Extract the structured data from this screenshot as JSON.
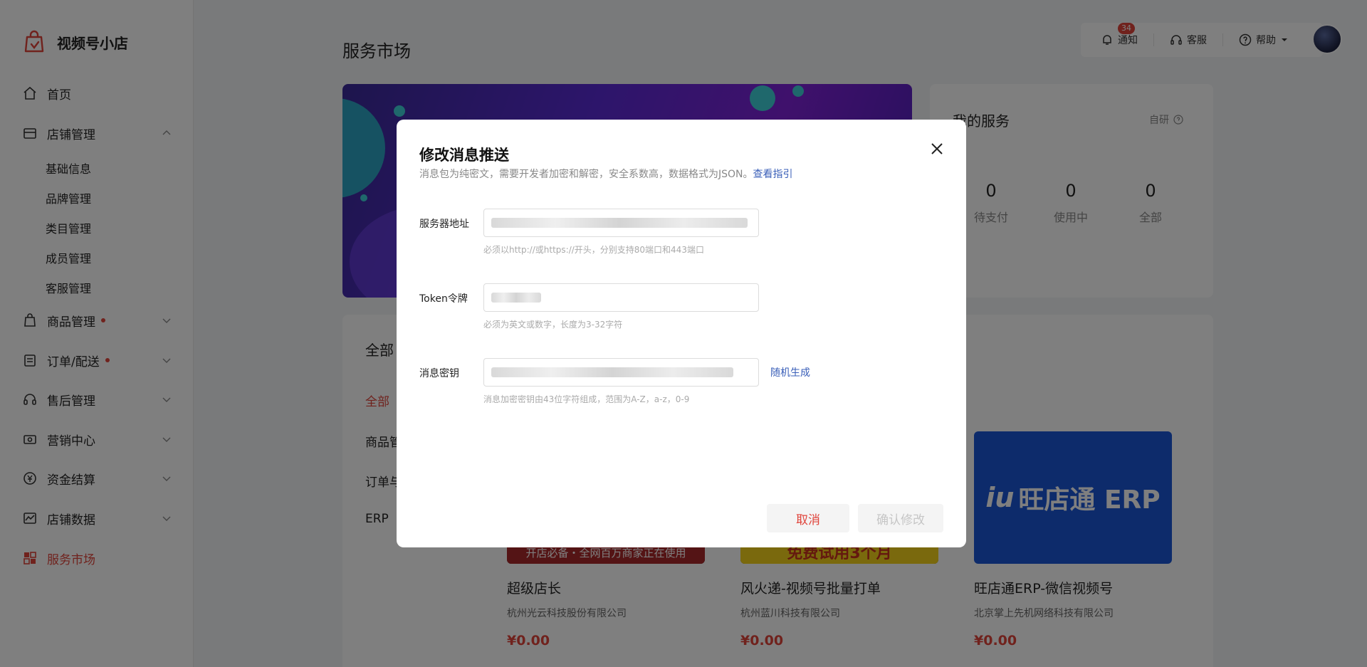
{
  "app": {
    "name": "视频号小店"
  },
  "sidebar": {
    "home": "首页",
    "store_mgmt": "店铺管理",
    "store_sub": [
      "基础信息",
      "品牌管理",
      "类目管理",
      "成员管理",
      "客服管理"
    ],
    "goods_mgmt": "商品管理",
    "orders": "订单/配送",
    "after_sales": "售后管理",
    "marketing": "营销中心",
    "finance": "资金结算",
    "store_data": "店铺数据",
    "service_market": "服务市场"
  },
  "header": {
    "page_title": "服务市场",
    "notify_label": "通知",
    "notify_count": "34",
    "support_label": "客服",
    "help_label": "帮助"
  },
  "my_service": {
    "title": "我的服务",
    "self_label": "自研",
    "stats": [
      {
        "value": "0",
        "label": "待支付"
      },
      {
        "value": "0",
        "label": "使用中"
      },
      {
        "value": "0",
        "label": "全部"
      }
    ]
  },
  "market": {
    "title": "全部",
    "categories": [
      "全部",
      "商品管",
      "订单与",
      "ERP"
    ],
    "products": [
      {
        "name": "超级店长",
        "company": "杭州光云科技股份有限公司",
        "price": "¥0.00",
        "banner_text": "开店必备・全网百万商家正在使用"
      },
      {
        "name": "风火递-视频号批量打单",
        "company": "杭州蓝川科技有限公司",
        "price": "¥0.00",
        "banner_text": "免费试用3个月"
      },
      {
        "name": "旺店通ERP-微信视频号",
        "company": "北京掌上先机网络科技有限公司",
        "price": "¥0.00",
        "logo_text": "旺店通 ERP"
      }
    ]
  },
  "dialog": {
    "title": "修改消息推送",
    "description": "消息包为纯密文，需要开发者加密和解密，安全系数高，数据格式为JSON。",
    "guide_link": "查看指引",
    "server_label": "服务器地址",
    "server_hint": "必须以http://或https://开头，分别支持80端口和443端口",
    "token_label": "Token令牌",
    "token_hint": "必须为英文或数字，长度为3-32字符",
    "key_label": "消息密钥",
    "key_hint": "消息加密密钥由43位字符组成，范围为A-Z，a-z，0-9",
    "random_label": "随机生成",
    "cancel_label": "取消",
    "confirm_label": "确认修改"
  },
  "colors": {
    "accent": "#e0443b",
    "link": "#3a5fb8",
    "erp_blue": "#1a56d6"
  }
}
